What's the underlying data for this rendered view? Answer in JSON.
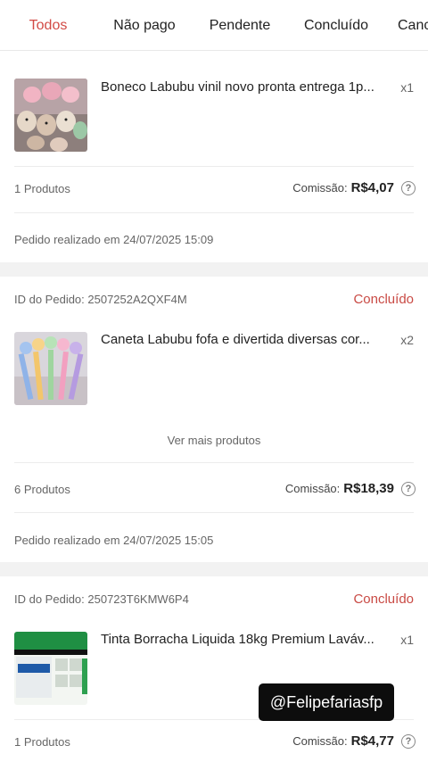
{
  "tabs": [
    {
      "label": "Todos"
    },
    {
      "label": "Não pago"
    },
    {
      "label": "Pendente"
    },
    {
      "label": "Concluído"
    },
    {
      "label": "Canc"
    }
  ],
  "colors": {
    "accent": "#d24a45",
    "background_gap": "#f2f2f2"
  },
  "orders": [
    {
      "product": "Boneco Labubu vinil novo pronta entrega 1p...",
      "qty": "x1",
      "products_count": "1 Produtos",
      "commission_label": "Comissão:",
      "commission_value": "R$4,07",
      "placed": "Pedido realizado em 24/07/2025 15:09"
    },
    {
      "order_id": "ID do Pedido: 2507252A2QXF4M",
      "status": "Concluído",
      "product": "Caneta Labubu fofa e divertida diversas cor...",
      "qty": "x2",
      "more": "Ver mais produtos",
      "products_count": "6 Produtos",
      "commission_label": "Comissão:",
      "commission_value": "R$18,39",
      "placed": "Pedido realizado em 24/07/2025 15:05"
    },
    {
      "order_id": "ID do Pedido: 250723T6KMW6P4",
      "status": "Concluído",
      "product": "Tinta Borracha Liquida 18kg Premium Laváv...",
      "qty": "x1",
      "products_count": "1 Produtos",
      "commission_label": "Comissão:",
      "commission_value": "R$4,77"
    }
  ],
  "watermark": "@Felipefariasfp"
}
